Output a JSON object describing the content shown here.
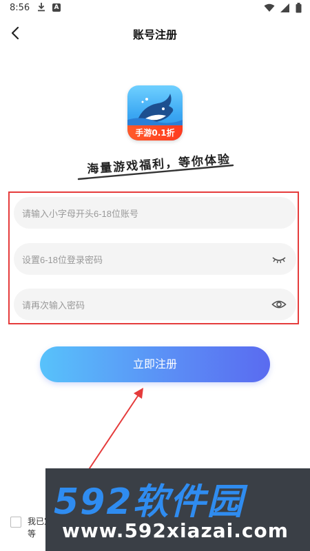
{
  "status_bar": {
    "time": "8:56",
    "icons": [
      "download-icon",
      "a-badge-icon",
      "wifi-icon",
      "signal-icon",
      "battery-icon"
    ]
  },
  "nav": {
    "title": "账号注册",
    "back_icon": "chevron-left-icon"
  },
  "logo": {
    "badge_text": "手游0.1折",
    "slogan": "海量游戏福利，等你体验"
  },
  "form": {
    "account": {
      "placeholder": "请输入小字母开头6-18位账号",
      "value": ""
    },
    "password": {
      "placeholder": "设置6-18位登录密码",
      "value": "",
      "icon": "eye-closed-icon"
    },
    "confirm_password": {
      "placeholder": "请再次输入密码",
      "value": "",
      "icon": "eye-open-icon"
    },
    "highlight_color": "#e53b3b"
  },
  "register_button": {
    "label": "立即注册"
  },
  "agreement": {
    "text": "我已定等"
  },
  "watermark": {
    "title": "592软件园",
    "url": "www.592xiazai.com"
  },
  "colors": {
    "accent_start": "#58c2fb",
    "accent_end": "#5a6bf0",
    "annotation": "#e53b3b"
  }
}
